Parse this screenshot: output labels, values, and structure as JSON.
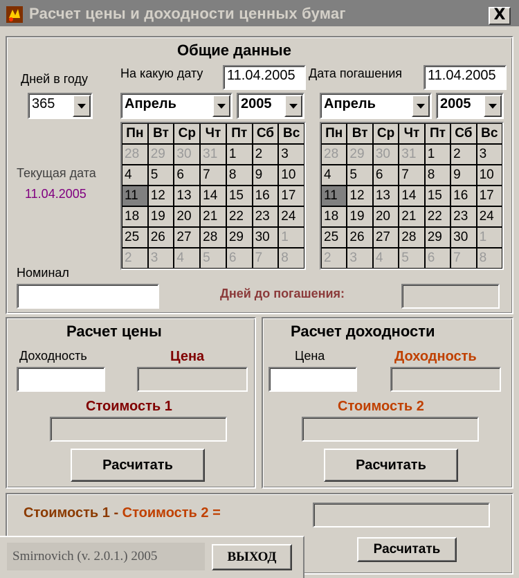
{
  "window": {
    "title": "Расчет цены и доходности ценных бумаг",
    "close": "X"
  },
  "general": {
    "heading": "Общие данные",
    "days_in_year_label": "Дней в году",
    "days_in_year_value": "365",
    "on_date_label": "На какую дату",
    "on_date_value": "11.04.2005",
    "maturity_label": "Дата погашения",
    "maturity_value": "11.04.2005",
    "current_date_label": "Текущая дата",
    "current_date_value": "11.04.2005",
    "nominal_label": "Номинал",
    "nominal_value": "",
    "days_to_maturity_label": "Дней до погашения:",
    "days_to_maturity_value": ""
  },
  "calendars": [
    {
      "month": "Апрель",
      "year": "2005",
      "weekdays": [
        "Пн",
        "Вт",
        "Ср",
        "Чт",
        "Пт",
        "Сб",
        "Вс"
      ],
      "days": [
        "28",
        "29",
        "30",
        "31",
        "1",
        "2",
        "3",
        "4",
        "5",
        "6",
        "7",
        "8",
        "9",
        "10",
        "11",
        "12",
        "13",
        "14",
        "15",
        "16",
        "17",
        "18",
        "19",
        "20",
        "21",
        "22",
        "23",
        "24",
        "25",
        "26",
        "27",
        "28",
        "29",
        "30",
        "1",
        "2",
        "3",
        "4",
        "5",
        "6",
        "7",
        "8"
      ],
      "selected": "11"
    },
    {
      "month": "Апрель",
      "year": "2005",
      "weekdays": [
        "Пн",
        "Вт",
        "Ср",
        "Чт",
        "Пт",
        "Сб",
        "Вс"
      ],
      "days": [
        "28",
        "29",
        "30",
        "31",
        "1",
        "2",
        "3",
        "4",
        "5",
        "6",
        "7",
        "8",
        "9",
        "10",
        "11",
        "12",
        "13",
        "14",
        "15",
        "16",
        "17",
        "18",
        "19",
        "20",
        "21",
        "22",
        "23",
        "24",
        "25",
        "26",
        "27",
        "28",
        "29",
        "30",
        "1",
        "2",
        "3",
        "4",
        "5",
        "6",
        "7",
        "8"
      ],
      "selected": "11"
    }
  ],
  "price_calc": {
    "heading": "Расчет цены",
    "yield_label": "Доходность",
    "yield_value": "",
    "price_label": "Цена",
    "price_value": "",
    "cost1_label": "Стоимость 1",
    "cost1_value": "",
    "button": "Расчитать"
  },
  "yield_calc": {
    "heading": "Расчет доходности",
    "price_label": "Цена",
    "price_value": "",
    "yield_label": "Доходность",
    "yield_value": "",
    "cost2_label": "Стоимость 2",
    "cost2_value": "",
    "button": "Расчитать"
  },
  "difference": {
    "label_cost1": "Стоимость 1",
    "minus": "-",
    "label_cost2": "Стоимость 2 =",
    "value": "",
    "button": "Расчитать"
  },
  "footer": {
    "version": "Smirnovich (v. 2.0.1.) 2005",
    "exit": "ВЫХОД"
  },
  "colors": {
    "face": "#d4d0c8",
    "dark_red": "#800000",
    "orange": "#c04000",
    "purple": "#800080"
  }
}
